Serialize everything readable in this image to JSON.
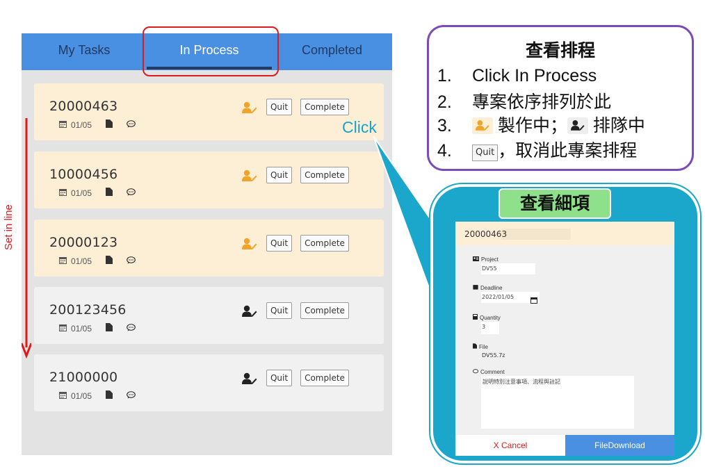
{
  "tabs": [
    {
      "label": "My Tasks"
    },
    {
      "label": "In Process"
    },
    {
      "label": "Completed"
    }
  ],
  "cards": [
    {
      "order": "20000463",
      "date": "01/05",
      "status": "working",
      "quit_label": "Quit",
      "complete_label": "Complete"
    },
    {
      "order": "10000456",
      "date": "01/05",
      "status": "working",
      "quit_label": "Quit",
      "complete_label": "Complete"
    },
    {
      "order": "20000123",
      "date": "01/05",
      "status": "working",
      "quit_label": "Quit",
      "complete_label": "Complete"
    },
    {
      "order": "200123456",
      "date": "01/05",
      "status": "queued",
      "quit_label": "Quit",
      "complete_label": "Complete"
    },
    {
      "order": "21000000",
      "date": "01/05",
      "status": "queued",
      "quit_label": "Quit",
      "complete_label": "Complete"
    }
  ],
  "annotations": {
    "set_in_line": "Set in line",
    "click": "Click"
  },
  "instructions": {
    "title": "查看排程",
    "steps": [
      {
        "num": "1.",
        "text": "Click In Process"
      },
      {
        "num": "2.",
        "text": "專案依序排列於此"
      },
      {
        "num": "3.",
        "text_a": "製作中；",
        "text_b": "排隊中"
      },
      {
        "num": "4.",
        "quit_label": "Quit",
        "text": "，取消此專案排程"
      }
    ]
  },
  "detail": {
    "title": "查看細項",
    "order": "20000463",
    "project_label": "Project",
    "project_value": "DV55",
    "deadline_label": "Deadline",
    "deadline_value": "2022/01/05",
    "quantity_label": "Quantity",
    "quantity_value": "3",
    "file_label": "File",
    "file_value": "DV55.7z",
    "comment_label": "Comment",
    "comment_value": "說明特別注意事項、流程與註記",
    "cancel_label": "X  Cancel",
    "download_label": "FileDownload"
  },
  "colors": {
    "accent_blue": "#4a90e2",
    "working_bg": "#fdefd6",
    "working_icon": "#f0a52a",
    "queued_icon": "#222222",
    "highlight_red": "#e0191c",
    "callout_teal": "#1ba7cb",
    "instruction_border": "#7b4bb8",
    "detail_title_bg": "#8fe08a"
  },
  "icons": [
    "calendar-icon",
    "document-icon",
    "comment-icon",
    "user-edit-icon",
    "id-card-icon",
    "calculator-icon"
  ]
}
